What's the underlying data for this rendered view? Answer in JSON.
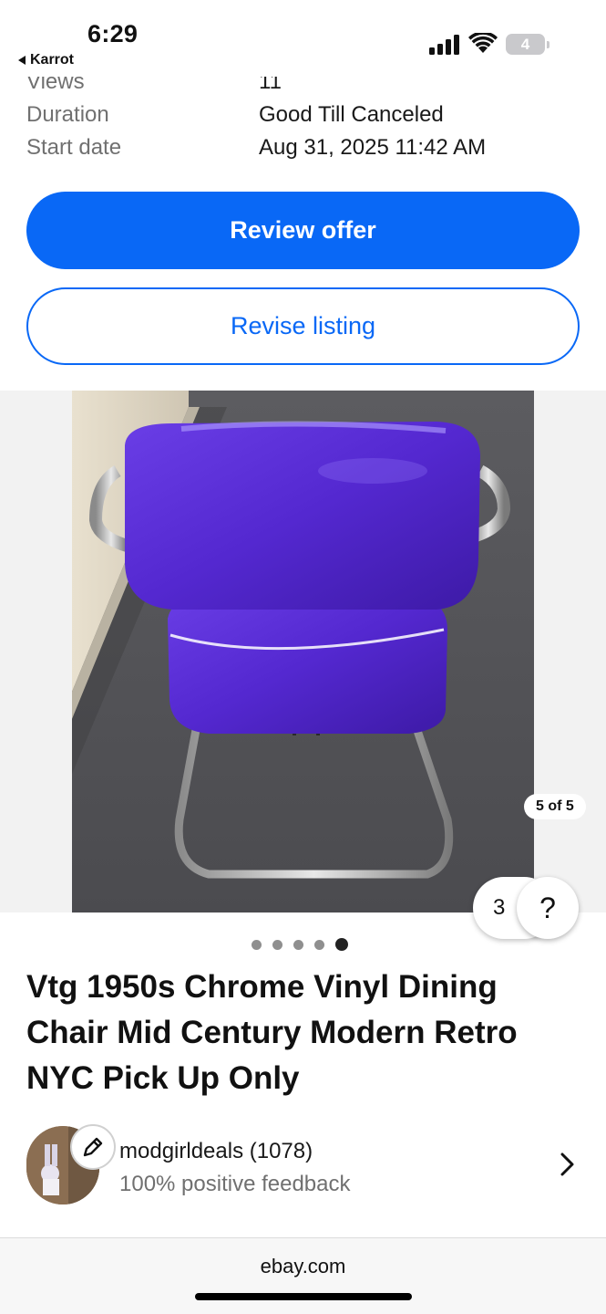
{
  "status_bar": {
    "time": "6:29",
    "back_app": "Karrot",
    "battery": "4"
  },
  "details": {
    "partial_row": {
      "label": "Views",
      "value": "11"
    },
    "rows": [
      {
        "label": "Duration",
        "value": "Good Till Canceled"
      },
      {
        "label": "Start date",
        "value": "Aug 31, 2025 11:42 AM"
      }
    ]
  },
  "actions": {
    "review_offer": "Review offer",
    "revise_listing": "Revise listing"
  },
  "gallery": {
    "counter": "5 of 5",
    "current_index": 5,
    "total": 5,
    "float_count": "3",
    "help_label": "?"
  },
  "listing": {
    "title": "Vtg 1950s Chrome Vinyl Dining Chair Mid Century Modern Retro NYC Pick Up Only"
  },
  "seller": {
    "name": "modgirldeals (1078)",
    "feedback": "100% positive feedback"
  },
  "browser": {
    "url": "ebay.com"
  },
  "colors": {
    "accent": "#0968f6",
    "muted_text": "#707070"
  }
}
